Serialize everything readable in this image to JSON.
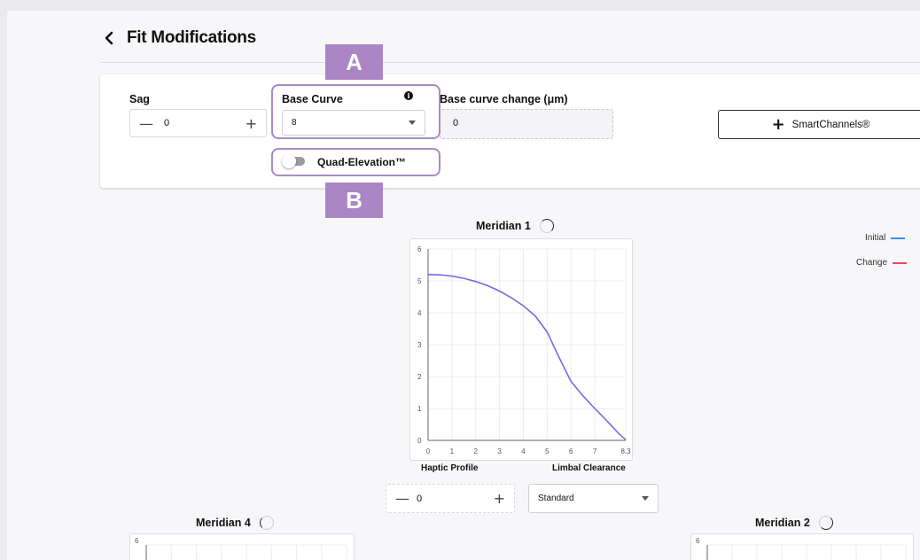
{
  "header": {
    "title": "Fit Modifications"
  },
  "sag": {
    "label": "Sag",
    "value": "0",
    "minus": "—",
    "plus": "+"
  },
  "base_curve": {
    "label": "Base Curve",
    "value": "8",
    "info": "i"
  },
  "base_curve_change": {
    "label": "Base curve change (μm)",
    "value": "0"
  },
  "smartchannels": {
    "plus": "+",
    "label": "SmartChannels®"
  },
  "quad_elevation": {
    "label": "Quad-Elevation™",
    "enabled": false
  },
  "annotations": {
    "a": "A",
    "b": "B",
    "color": "#ab85c4"
  },
  "legend": {
    "initial": {
      "label": "Initial",
      "color": "#3b8fe6"
    },
    "change": {
      "label": "Change",
      "color": "#e94b4b"
    }
  },
  "meridian1": {
    "title": "Meridian 1",
    "xlabel_left": "Haptic Profile",
    "xlabel_right": "Limbal Clearance",
    "stepper": {
      "minus": "—",
      "value": "0",
      "plus": "+"
    },
    "select": "Standard"
  },
  "meridian4": {
    "title": "Meridian 4",
    "y_top_label": "6"
  },
  "meridian2": {
    "title": "Meridian 2",
    "y_top_label": "6"
  },
  "chart_data": {
    "type": "line",
    "title": "Meridian 1",
    "xlabel": "Haptic Profile / Limbal Clearance",
    "ylabel": "",
    "x_ticks": [
      "0",
      "1",
      "2",
      "3",
      "4",
      "5",
      "6",
      "7",
      "8.3"
    ],
    "y_ticks": [
      "0",
      "1",
      "2",
      "3",
      "4",
      "5",
      "6"
    ],
    "xlim": [
      0,
      8.3
    ],
    "ylim": [
      0,
      6
    ],
    "grid": true,
    "series": [
      {
        "color": "#7b68e6",
        "x": [
          0,
          0.5,
          1,
          1.5,
          2,
          2.5,
          3,
          3.5,
          4,
          4.5,
          5,
          5.5,
          6,
          6.5,
          7,
          7.5,
          8,
          8.3
        ],
        "y": [
          5.2,
          5.19,
          5.15,
          5.08,
          4.98,
          4.85,
          4.68,
          4.47,
          4.22,
          3.9,
          3.4,
          2.6,
          1.85,
          1.4,
          1.0,
          0.62,
          0.22,
          0.02
        ]
      }
    ]
  }
}
